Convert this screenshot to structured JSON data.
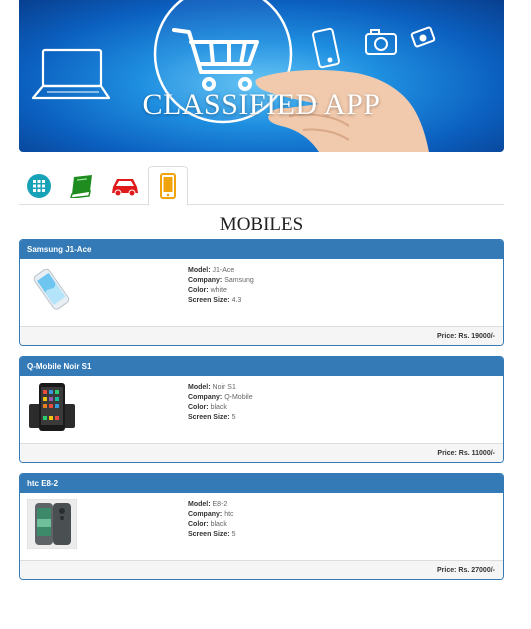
{
  "banner": {
    "title": "CLASSIFIED APP"
  },
  "tabs": [
    {
      "icon": "grid-icon",
      "color": "#17a2b8"
    },
    {
      "icon": "book-icon",
      "color": "#1e8c1e"
    },
    {
      "icon": "car-icon",
      "color": "#e01a1a"
    },
    {
      "icon": "mobile-icon",
      "color": "#f0a30a",
      "active": true
    }
  ],
  "section": {
    "title": "MOBILES"
  },
  "labels": {
    "model": "Model:",
    "company": "Company:",
    "color": "Color:",
    "screen": "Screen Size:"
  },
  "products": [
    {
      "name": "Samsung J1-Ace",
      "model": "J1-Ace",
      "company": "Samsung",
      "color": "white",
      "screen": "4.3",
      "price": "Price: Rs. 19000/-"
    },
    {
      "name": "Q-Mobile Noir S1",
      "model": "Noir S1",
      "company": "Q-Mobile",
      "color": "black",
      "screen": "5",
      "price": "Price: Rs. 11000/-"
    },
    {
      "name": "htc E8-2",
      "model": "E8-2",
      "company": "htc",
      "color": "black",
      "screen": "5",
      "price": "Price: Rs. 27000/-"
    }
  ],
  "colors": {
    "primary": "#337ab7",
    "footer": "#f5f5f5"
  }
}
